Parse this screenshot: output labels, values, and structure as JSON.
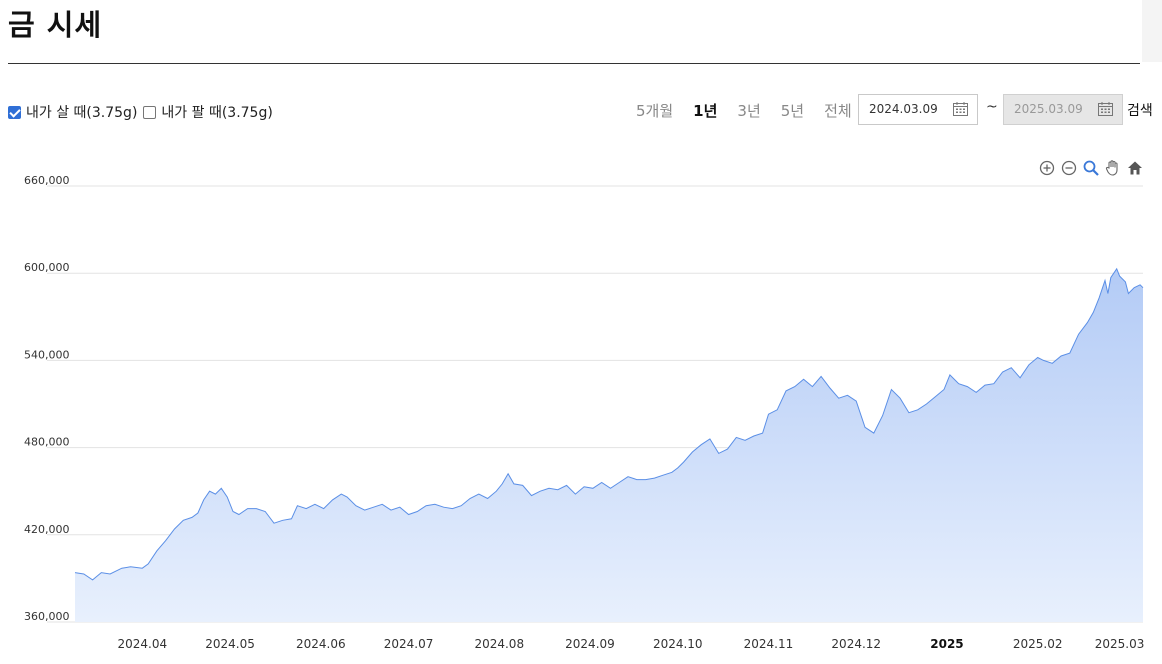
{
  "page": {
    "title": "금 시세"
  },
  "filters": {
    "buy": {
      "label": "내가 살 때(3.75g)",
      "checked": true
    },
    "sell": {
      "label": "내가 팔 때(3.75g)",
      "checked": false
    }
  },
  "periods": [
    {
      "label": "5개월",
      "active": false
    },
    {
      "label": "1년",
      "active": true
    },
    {
      "label": "3년",
      "active": false
    },
    {
      "label": "5년",
      "active": false
    },
    {
      "label": "전체",
      "active": false
    }
  ],
  "date_range": {
    "start": "2024.03.09",
    "separator": "~",
    "end": "2025.03.09"
  },
  "search_label": "검색",
  "toolbar": [
    "zoom-in-icon",
    "zoom-out-icon",
    "magnify-icon",
    "pan-hand-icon",
    "home-icon"
  ],
  "colors": {
    "line": "#5b8fe6",
    "fill_top": "#b3cbf6",
    "fill_bottom": "#e8f0fd",
    "grid": "#e3e3e3",
    "accent": "#2f6fd6"
  },
  "chart_data": {
    "type": "area",
    "title": "",
    "xlabel": "",
    "ylabel": "",
    "ylim": [
      360000,
      660000
    ],
    "xlim": [
      "2024-03-09",
      "2025-03-09"
    ],
    "yticks": [
      360000,
      420000,
      480000,
      540000,
      600000,
      660000
    ],
    "ytick_labels": [
      "360,000",
      "420,000",
      "480,000",
      "540,000",
      "600,000",
      "660,000"
    ],
    "xticks": [
      {
        "date": "2024-04-01",
        "label": "2024.04",
        "bold": false
      },
      {
        "date": "2024-05-01",
        "label": "2024.05",
        "bold": false
      },
      {
        "date": "2024-06-01",
        "label": "2024.06",
        "bold": false
      },
      {
        "date": "2024-07-01",
        "label": "2024.07",
        "bold": false
      },
      {
        "date": "2024-08-01",
        "label": "2024.08",
        "bold": false
      },
      {
        "date": "2024-09-01",
        "label": "2024.09",
        "bold": false
      },
      {
        "date": "2024-10-01",
        "label": "2024.10",
        "bold": false
      },
      {
        "date": "2024-11-01",
        "label": "2024.11",
        "bold": false
      },
      {
        "date": "2024-12-01",
        "label": "2024.12",
        "bold": false
      },
      {
        "date": "2025-01-01",
        "label": "2025",
        "bold": true
      },
      {
        "date": "2025-02-01",
        "label": "2025.02",
        "bold": false
      },
      {
        "date": "2025-03-01",
        "label": "2025.03",
        "bold": false
      }
    ],
    "grid": true,
    "series": [
      {
        "name": "",
        "points": [
          [
            "2024-03-09",
            394000
          ],
          [
            "2024-03-12",
            393000
          ],
          [
            "2024-03-15",
            389000
          ],
          [
            "2024-03-18",
            394000
          ],
          [
            "2024-03-21",
            393000
          ],
          [
            "2024-03-25",
            397000
          ],
          [
            "2024-03-28",
            398000
          ],
          [
            "2024-04-01",
            397000
          ],
          [
            "2024-04-03",
            400000
          ],
          [
            "2024-04-06",
            409000
          ],
          [
            "2024-04-09",
            416000
          ],
          [
            "2024-04-12",
            424000
          ],
          [
            "2024-04-15",
            430000
          ],
          [
            "2024-04-18",
            432000
          ],
          [
            "2024-04-20",
            435000
          ],
          [
            "2024-04-22",
            444000
          ],
          [
            "2024-04-24",
            450000
          ],
          [
            "2024-04-26",
            448000
          ],
          [
            "2024-04-28",
            452000
          ],
          [
            "2024-04-30",
            446000
          ],
          [
            "2024-05-02",
            436000
          ],
          [
            "2024-05-04",
            434000
          ],
          [
            "2024-05-07",
            438000
          ],
          [
            "2024-05-10",
            438000
          ],
          [
            "2024-05-13",
            436000
          ],
          [
            "2024-05-16",
            428000
          ],
          [
            "2024-05-19",
            430000
          ],
          [
            "2024-05-22",
            431000
          ],
          [
            "2024-05-24",
            440000
          ],
          [
            "2024-05-27",
            438000
          ],
          [
            "2024-05-30",
            441000
          ],
          [
            "2024-06-02",
            438000
          ],
          [
            "2024-06-05",
            444000
          ],
          [
            "2024-06-08",
            448000
          ],
          [
            "2024-06-10",
            446000
          ],
          [
            "2024-06-13",
            440000
          ],
          [
            "2024-06-16",
            437000
          ],
          [
            "2024-06-19",
            439000
          ],
          [
            "2024-06-22",
            441000
          ],
          [
            "2024-06-25",
            437000
          ],
          [
            "2024-06-28",
            439000
          ],
          [
            "2024-07-01",
            434000
          ],
          [
            "2024-07-04",
            436000
          ],
          [
            "2024-07-07",
            440000
          ],
          [
            "2024-07-10",
            441000
          ],
          [
            "2024-07-13",
            439000
          ],
          [
            "2024-07-16",
            438000
          ],
          [
            "2024-07-19",
            440000
          ],
          [
            "2024-07-22",
            445000
          ],
          [
            "2024-07-25",
            448000
          ],
          [
            "2024-07-28",
            445000
          ],
          [
            "2024-07-31",
            450000
          ],
          [
            "2024-08-02",
            455000
          ],
          [
            "2024-08-04",
            462000
          ],
          [
            "2024-08-06",
            455000
          ],
          [
            "2024-08-09",
            454000
          ],
          [
            "2024-08-12",
            447000
          ],
          [
            "2024-08-15",
            450000
          ],
          [
            "2024-08-18",
            452000
          ],
          [
            "2024-08-21",
            451000
          ],
          [
            "2024-08-24",
            454000
          ],
          [
            "2024-08-27",
            448000
          ],
          [
            "2024-08-30",
            453000
          ],
          [
            "2024-09-02",
            452000
          ],
          [
            "2024-09-05",
            456000
          ],
          [
            "2024-09-08",
            452000
          ],
          [
            "2024-09-11",
            456000
          ],
          [
            "2024-09-14",
            460000
          ],
          [
            "2024-09-17",
            458000
          ],
          [
            "2024-09-20",
            458000
          ],
          [
            "2024-09-23",
            459000
          ],
          [
            "2024-09-26",
            461000
          ],
          [
            "2024-09-29",
            463000
          ],
          [
            "2024-10-01",
            466000
          ],
          [
            "2024-10-03",
            470000
          ],
          [
            "2024-10-06",
            477000
          ],
          [
            "2024-10-09",
            482000
          ],
          [
            "2024-10-12",
            486000
          ],
          [
            "2024-10-15",
            476000
          ],
          [
            "2024-10-18",
            479000
          ],
          [
            "2024-10-21",
            487000
          ],
          [
            "2024-10-24",
            485000
          ],
          [
            "2024-10-27",
            488000
          ],
          [
            "2024-10-30",
            490000
          ],
          [
            "2024-11-01",
            503000
          ],
          [
            "2024-11-04",
            506000
          ],
          [
            "2024-11-07",
            519000
          ],
          [
            "2024-11-10",
            522000
          ],
          [
            "2024-11-13",
            527000
          ],
          [
            "2024-11-16",
            522000
          ],
          [
            "2024-11-19",
            529000
          ],
          [
            "2024-11-22",
            521000
          ],
          [
            "2024-11-25",
            514000
          ],
          [
            "2024-11-28",
            516000
          ],
          [
            "2024-12-01",
            512000
          ],
          [
            "2024-12-04",
            494000
          ],
          [
            "2024-12-07",
            490000
          ],
          [
            "2024-12-10",
            502000
          ],
          [
            "2024-12-13",
            520000
          ],
          [
            "2024-12-16",
            514000
          ],
          [
            "2024-12-19",
            504000
          ],
          [
            "2024-12-22",
            506000
          ],
          [
            "2024-12-25",
            510000
          ],
          [
            "2024-12-28",
            515000
          ],
          [
            "2024-12-31",
            520000
          ],
          [
            "2025-01-02",
            530000
          ],
          [
            "2025-01-05",
            524000
          ],
          [
            "2025-01-08",
            522000
          ],
          [
            "2025-01-11",
            518000
          ],
          [
            "2025-01-14",
            523000
          ],
          [
            "2025-01-17",
            524000
          ],
          [
            "2025-01-20",
            532000
          ],
          [
            "2025-01-23",
            535000
          ],
          [
            "2025-01-26",
            528000
          ],
          [
            "2025-01-29",
            537000
          ],
          [
            "2025-02-01",
            542000
          ],
          [
            "2025-02-03",
            540000
          ],
          [
            "2025-02-06",
            538000
          ],
          [
            "2025-02-09",
            543000
          ],
          [
            "2025-02-12",
            545000
          ],
          [
            "2025-02-15",
            558000
          ],
          [
            "2025-02-18",
            566000
          ],
          [
            "2025-02-20",
            573000
          ],
          [
            "2025-02-22",
            583000
          ],
          [
            "2025-02-24",
            595000
          ],
          [
            "2025-02-25",
            586000
          ],
          [
            "2025-02-26",
            597000
          ],
          [
            "2025-02-28",
            603000
          ],
          [
            "2025-03-01",
            598000
          ],
          [
            "2025-03-03",
            594000
          ],
          [
            "2025-03-04",
            586000
          ],
          [
            "2025-03-06",
            590000
          ],
          [
            "2025-03-08",
            592000
          ],
          [
            "2025-03-09",
            590000
          ]
        ]
      }
    ]
  }
}
